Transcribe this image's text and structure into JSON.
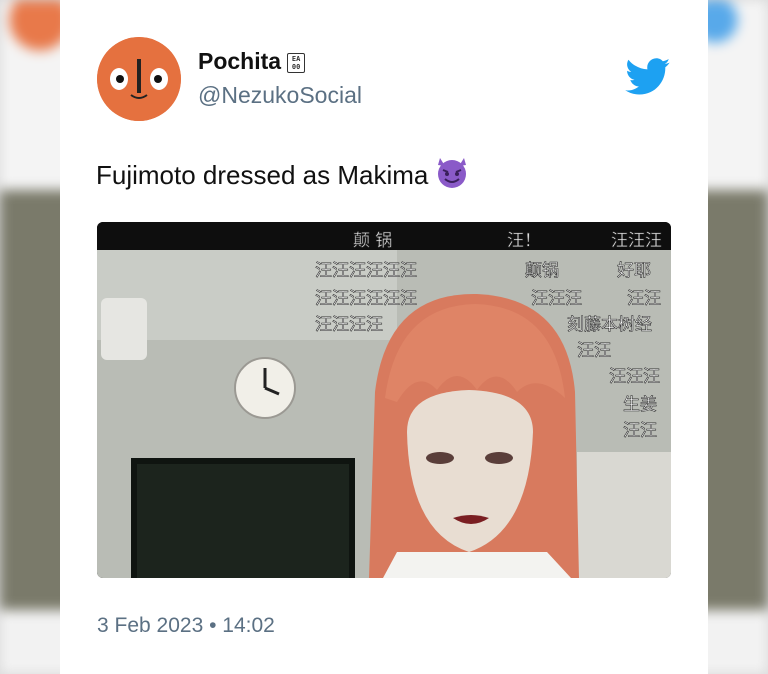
{
  "tweet": {
    "display_name": "Pochita",
    "verified_badge_text": "EA\n00",
    "handle": "@NezukoSocial",
    "text": "Fujimoto dressed as Makima",
    "emoji": "smiling-devil",
    "timestamp": "3 Feb 2023 • 14:02"
  },
  "media": {
    "description_icon": "cosplay-photo",
    "danmaku": [
      "颠  锅",
      "汪！",
      "汪汪汪",
      "汪汪汪汪汪汪",
      "颠锅",
      "好耶",
      "汪汪汪汪汪汪",
      "汪汪汪",
      "汪汪",
      "汪汪汪汪",
      "刻藤本树经",
      "汪汪",
      "汪汪汪",
      "生姜",
      "汪汪"
    ]
  },
  "colors": {
    "avatar": "#e5713f",
    "twitter_blue": "#1da1f2",
    "muted_text": "#5b7083",
    "devil_purple": "#8a5ac8"
  }
}
